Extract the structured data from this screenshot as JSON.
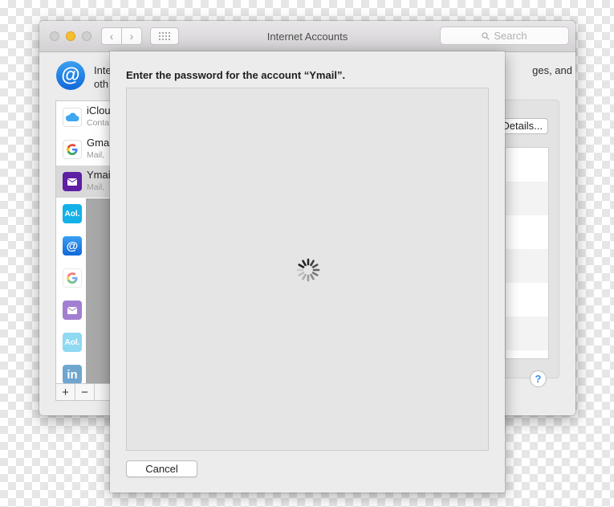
{
  "window": {
    "title": "Internet Accounts",
    "search_placeholder": "Search",
    "nav_back": "‹",
    "nav_forward": "›"
  },
  "header": {
    "line1": "Inte",
    "line2": "oth",
    "line1_right": "ges, and"
  },
  "accounts": [
    {
      "name": "iClou",
      "sub": "Conta"
    },
    {
      "name": "Gma",
      "sub": "Mail,"
    },
    {
      "name": "Ymai",
      "sub": "Mail,"
    }
  ],
  "list_footer": {
    "add": "+",
    "remove": "−"
  },
  "details_button": "Details...",
  "help": "?",
  "sheet": {
    "title": "Enter the password for the account “Ymail”.",
    "cancel": "Cancel"
  },
  "icons": {
    "header": "at-sign-icon",
    "icloud": "icloud-icon",
    "google": "google-icon",
    "ymail": "mail-envelope-icon",
    "aol": "aol-icon",
    "linkedin": "linkedin-icon"
  },
  "colors": {
    "accent": "#1a7be8",
    "ymail_purple": "#5f1fa3",
    "aol_blue": "#13b1e8",
    "linkedin_blue": "#1b76b5"
  }
}
